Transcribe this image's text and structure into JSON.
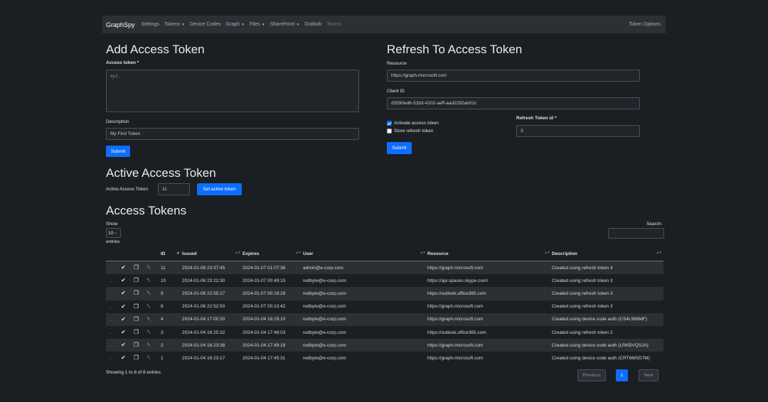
{
  "navbar": {
    "brand": "GraphSpy",
    "items": [
      {
        "label": "Settings",
        "dropdown": false,
        "disabled": false
      },
      {
        "label": "Tokens",
        "dropdown": true,
        "disabled": false
      },
      {
        "label": "Device Codes",
        "dropdown": false,
        "disabled": false
      },
      {
        "label": "Graph",
        "dropdown": true,
        "disabled": false
      },
      {
        "label": "Files",
        "dropdown": true,
        "disabled": false
      },
      {
        "label": "SharePoint",
        "dropdown": true,
        "disabled": false
      },
      {
        "label": "Outlook",
        "dropdown": false,
        "disabled": false
      },
      {
        "label": "Teams",
        "dropdown": false,
        "disabled": true
      }
    ],
    "right": "Token Options"
  },
  "add_access_token": {
    "title": "Add Access Token",
    "access_token_label": "Access token *",
    "access_token_placeholder": "eyJ...",
    "description_label": "Description",
    "description_value": "My First Token",
    "submit": "Submit"
  },
  "refresh_to_access": {
    "title": "Refresh To Access Token",
    "resource_label": "Resource",
    "resource_value": "https://graph.microsoft.com",
    "client_id_label": "Client ID",
    "client_id_value": "d3590ed6-52b3-4102-aeff-aad2292ab01c",
    "activate_label": "Activate access token",
    "activate_checked": true,
    "store_label": "Store refresh token",
    "store_checked": false,
    "refresh_token_id_label": "Refresh Token id *",
    "refresh_token_id_value": "3",
    "submit": "Submit"
  },
  "active_access_token": {
    "title": "Active Access Token",
    "label": "Active Access Token",
    "value": "11",
    "button": "Set active token"
  },
  "access_tokens": {
    "title": "Access Tokens",
    "show_label": "Show",
    "entries_value": "10",
    "entries_label": "entries",
    "search_label": "Search:",
    "columns": [
      "ID",
      "Issued",
      "Expires",
      "User",
      "Resource",
      "Description"
    ],
    "rows": [
      {
        "id": "11",
        "issued": "2024-01-06 23:37:45",
        "expires": "2024-01-07 01:07:38",
        "user": "admin@e-corp.com",
        "resource": "https://graph.microsoft.com",
        "description": "Created using refresh token 4"
      },
      {
        "id": "10",
        "issued": "2024-01-06 23:22:30",
        "expires": "2024-01-07 00:49:15",
        "user": "redbyte@e-corp.com",
        "resource": "https://api.spaces.skype.com/",
        "description": "Created using refresh token 3"
      },
      {
        "id": "9",
        "issued": "2024-01-06 22:55:17",
        "expires": "2024-01-07 00:19:28",
        "user": "redbyte@e-corp.com",
        "resource": "https://outlook.office365.com",
        "description": "Created using refresh token 3"
      },
      {
        "id": "8",
        "issued": "2024-01-06 22:52:50",
        "expires": "2024-01-07 00:13:42",
        "user": "redbyte@e-corp.com",
        "resource": "https://graph.microsoft.com",
        "description": "Created using refresh token 3"
      },
      {
        "id": "4",
        "issued": "2024-01-04 17:00:20",
        "expires": "2024-01-04 18:29:10",
        "user": "redbyte@e-corp.com",
        "resource": "https://graph.microsoft.com",
        "description": "Created using device code auth (CS4L968MF)"
      },
      {
        "id": "3",
        "issued": "2024-01-04 16:25:32",
        "expires": "2024-01-04 17:48:03",
        "user": "redbyte@e-corp.com",
        "resource": "https://outlook.office365.com",
        "description": "Created using refresh token 2"
      },
      {
        "id": "2",
        "issued": "2024-01-04 16:23:38",
        "expires": "2024-01-04 17:49:19",
        "user": "redbyte@e-corp.com",
        "resource": "https://graph.microsoft.com",
        "description": "Created using device code auth (LRKBVQSJA)"
      },
      {
        "id": "1",
        "issued": "2024-01-04 16:23:17",
        "expires": "2024-01-04 17:45:31",
        "user": "redbyte@e-corp.com",
        "resource": "https://graph.microsoft.com",
        "description": "Created using device code auth (CRT6MSD7M)"
      }
    ],
    "info": "Showing 1 to 8 of 8 entries",
    "pagination": {
      "previous": "Previous",
      "page": "1",
      "next": "Next"
    }
  },
  "icons": {
    "expand": "…",
    "activate": "✔",
    "copy": "❐",
    "delete": "␡"
  },
  "colors": {
    "accent": "#0d6efd",
    "background": "#1b1e22",
    "navbar": "#2b3035"
  }
}
